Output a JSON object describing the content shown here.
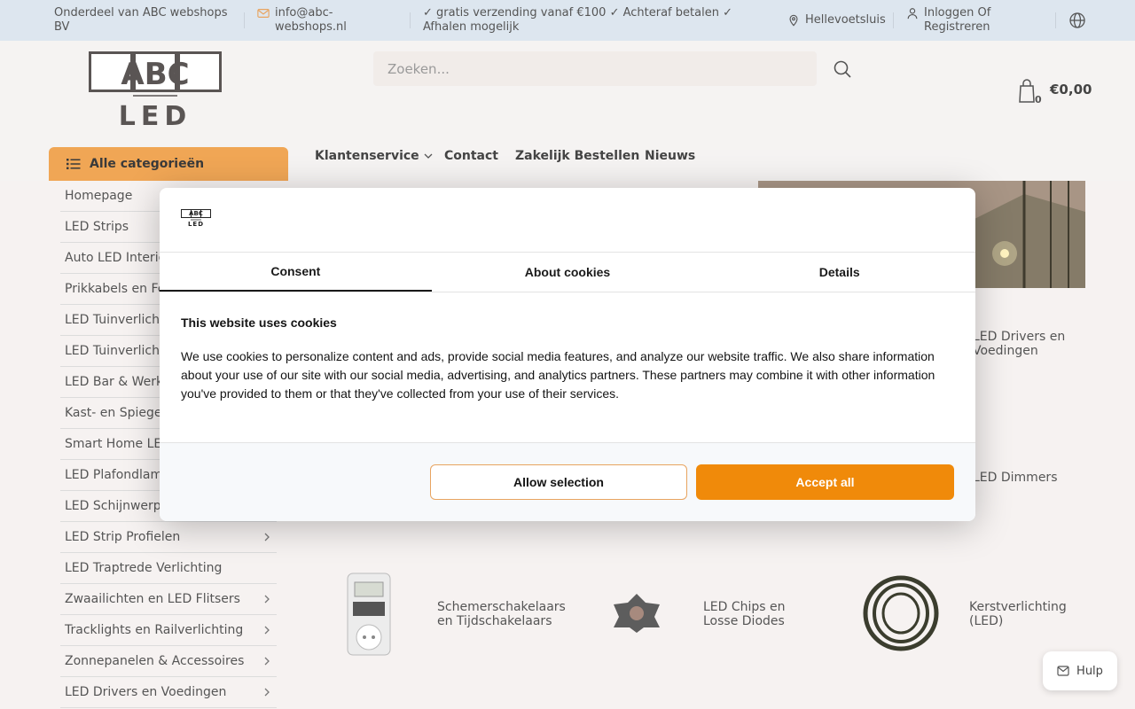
{
  "topbar": {
    "company": "Onderdeel van ABC webshops BV",
    "email": "info@abc-webshops.nl",
    "usp": "✓ gratis verzending vanaf €100 ✓ Achteraf betalen ✓ Afhalen mogelijk",
    "location": "Hellevoetsluis",
    "login": "Inloggen Of Registreren"
  },
  "header": {
    "logo_top": "ABC",
    "logo_bottom": "LED",
    "search_placeholder": "Zoeken...",
    "cart_count": "0",
    "cart_total": "€0,00"
  },
  "nav": {
    "categories_label": "Alle categorieën",
    "links": [
      "Klantenservice",
      "Contact",
      "Zakelijk Bestellen",
      "Nieuws"
    ]
  },
  "sidebar": {
    "items": [
      {
        "label": "Homepage",
        "chevron": false
      },
      {
        "label": "LED Strips",
        "chevron": false
      },
      {
        "label": "Auto LED Interie",
        "chevron": false
      },
      {
        "label": "Prikkabels en Fe",
        "chevron": false
      },
      {
        "label": "LED Tuinverlicht lampen",
        "chevron": false
      },
      {
        "label": "LED Tuinverlicht sets",
        "chevron": false
      },
      {
        "label": "LED Bar & Werkv",
        "chevron": false
      },
      {
        "label": "Kast- en Spiege",
        "chevron": false
      },
      {
        "label": "Smart Home LED",
        "chevron": false
      },
      {
        "label": "LED Plafondlamp",
        "chevron": false
      },
      {
        "label": "LED Schijnwerpers",
        "chevron": true
      },
      {
        "label": "LED Strip Profielen",
        "chevron": true
      },
      {
        "label": "LED Traptrede Verlichting",
        "chevron": false
      },
      {
        "label": "Zwaailichten en LED Flitsers",
        "chevron": true
      },
      {
        "label": "Tracklights en Railverlichting",
        "chevron": true
      },
      {
        "label": "Zonnepanelen & Accessoires",
        "chevron": true
      },
      {
        "label": "LED Drivers en Voedingen",
        "chevron": true
      }
    ]
  },
  "tiles": {
    "drivers": "LED Drivers en Voedingen",
    "dimmers": "LED Dimmers",
    "schemer": "Schemerschakelaars en Tijdschakelaars",
    "chips": "LED Chips en Losse Diodes",
    "kerst": "Kerstverlichting (LED)"
  },
  "cookie": {
    "logo_top": "ABC",
    "logo_bottom": "LED",
    "tabs": [
      "Consent",
      "About cookies",
      "Details"
    ],
    "title": "This website uses cookies",
    "body": "We use cookies to personalize content and ads, provide social media features, and analyze our website traffic. We also share information about your use of our site with our social media, advertising, and analytics partners. These partners may combine it with other information you've provided to them or that they've collected from your use of their services.",
    "allow_selection": "Allow selection",
    "accept_all": "Accept all"
  },
  "help": {
    "label": "Hulp"
  },
  "colors": {
    "accent": "#f08a0a",
    "category_bg": "#f0a655",
    "topbar_bg": "#dde6ef"
  }
}
